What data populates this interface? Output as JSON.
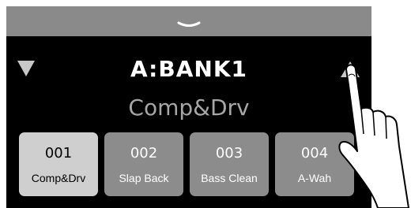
{
  "header": {
    "pull_icon": "chevron-down-icon"
  },
  "bank": {
    "title": "A:BANK1",
    "prev_icon": "triangle-down-icon",
    "next_icon": "triangle-up-icon"
  },
  "current_patch": {
    "name": "Comp&Drv"
  },
  "patches": [
    {
      "number": "001",
      "name": "Comp&Drv",
      "selected": true
    },
    {
      "number": "002",
      "name": "Slap Back",
      "selected": false
    },
    {
      "number": "003",
      "name": "Bass Clean",
      "selected": false
    },
    {
      "number": "004",
      "name": "A-Wah",
      "selected": false
    }
  ],
  "overlay": {
    "icon": "pointing-hand-icon"
  },
  "colors": {
    "screen_bg": "#000000",
    "pull_tab_bg": "#8a8a8a",
    "tile_bg": "#8c8c8c",
    "tile_selected_bg": "#cfcfcf",
    "patch_name_color": "#a6a6a6"
  }
}
